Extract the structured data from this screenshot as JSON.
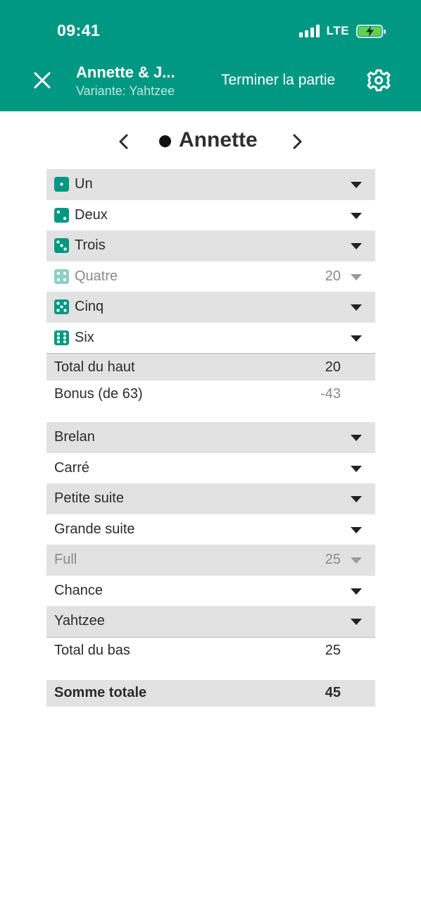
{
  "status": {
    "time": "09:41",
    "network": "LTE"
  },
  "header": {
    "title": "Annette & J...",
    "subtitle": "Variante: Yahtzee",
    "end_game": "Terminer la partie",
    "close_icon": "close-icon",
    "settings_icon": "gear-icon"
  },
  "player": {
    "name": "Annette"
  },
  "upper": [
    {
      "label": "Un",
      "value": "",
      "pips": 1,
      "disabled": false
    },
    {
      "label": "Deux",
      "value": "",
      "pips": 2,
      "disabled": false
    },
    {
      "label": "Trois",
      "value": "",
      "pips": 3,
      "disabled": false
    },
    {
      "label": "Quatre",
      "value": "20",
      "pips": 4,
      "disabled": true
    },
    {
      "label": "Cinq",
      "value": "",
      "pips": 5,
      "disabled": false
    },
    {
      "label": "Six",
      "value": "",
      "pips": 6,
      "disabled": false
    }
  ],
  "upper_total": {
    "label": "Total du haut",
    "value": "20"
  },
  "bonus": {
    "label": "Bonus (de 63)",
    "value": "-43"
  },
  "lower": [
    {
      "label": "Brelan",
      "value": "",
      "disabled": false
    },
    {
      "label": "Carré",
      "value": "",
      "disabled": false
    },
    {
      "label": "Petite suite",
      "value": "",
      "disabled": false
    },
    {
      "label": "Grande suite",
      "value": "",
      "disabled": false
    },
    {
      "label": "Full",
      "value": "25",
      "disabled": true
    },
    {
      "label": "Chance",
      "value": "",
      "disabled": false
    },
    {
      "label": "Yahtzee",
      "value": "",
      "disabled": false
    }
  ],
  "lower_total": {
    "label": "Total du bas",
    "value": "25"
  },
  "grand_total": {
    "label": "Somme totale",
    "value": "45"
  },
  "colors": {
    "accent": "#009882",
    "shade": "#e2e2e2",
    "die": "#009882",
    "battery": "#62d14f"
  }
}
